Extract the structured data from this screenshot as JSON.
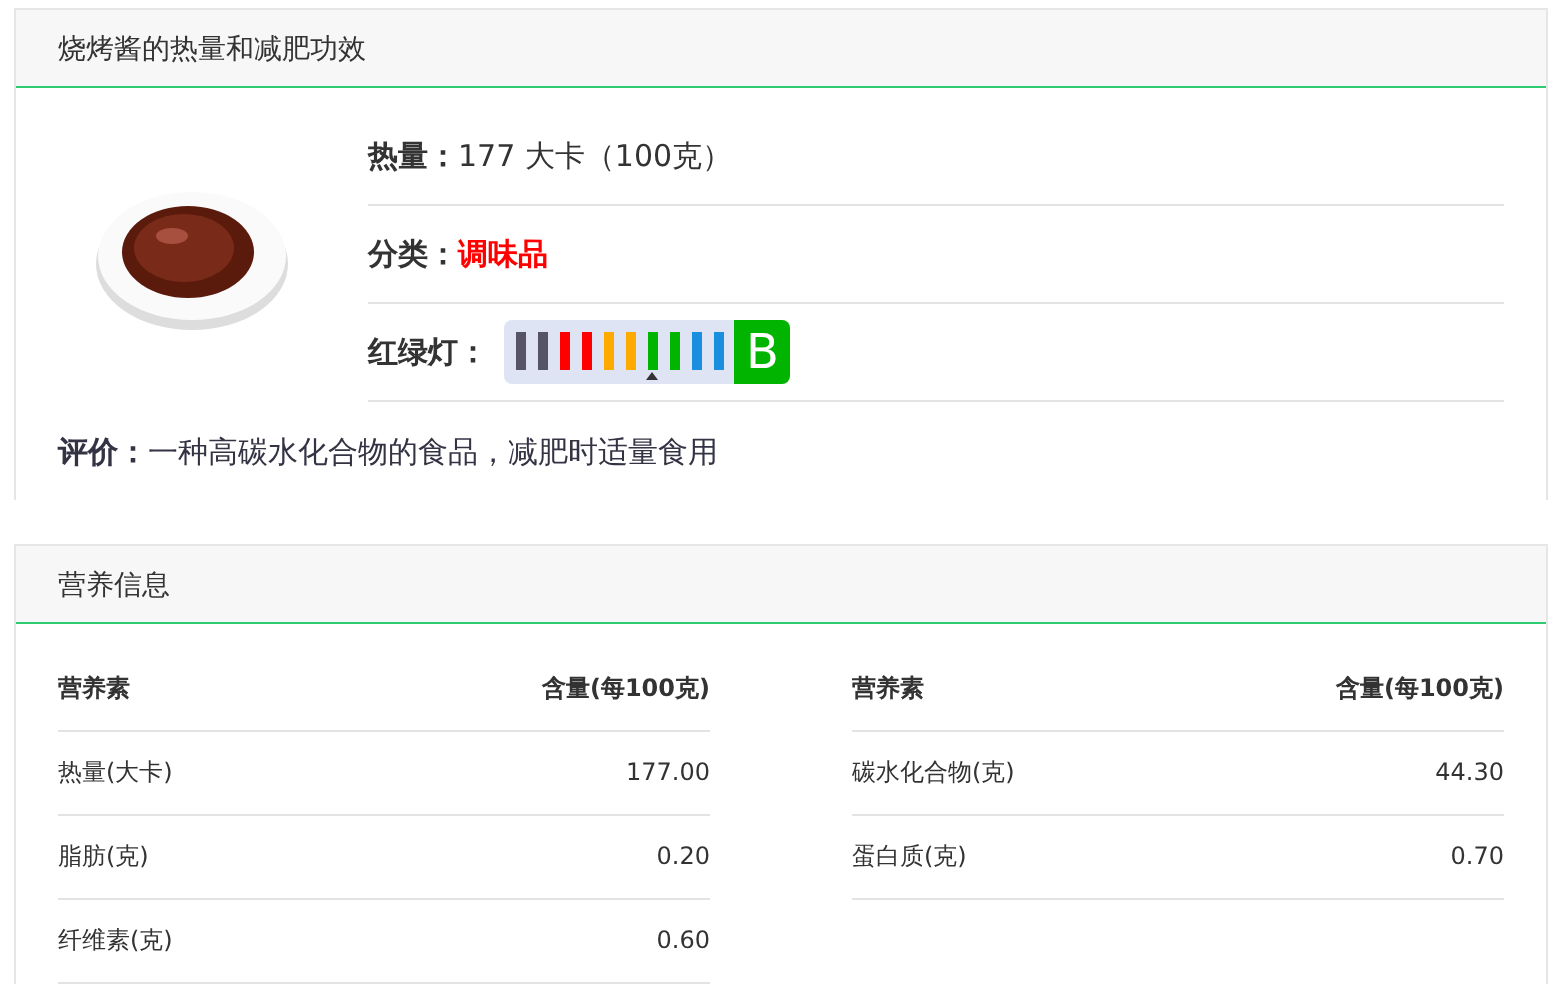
{
  "title": "烧烤酱的热量和减肥功效",
  "info": [
    {
      "kind": "text",
      "label": "热量：",
      "value": "177 大卡（100克）"
    },
    {
      "kind": "category",
      "label": "分类：",
      "value": "调味品",
      "color": "#ff0000"
    },
    {
      "kind": "light",
      "label": "红绿灯：",
      "segments": [
        {
          "color": "#555566",
          "selected": false
        },
        {
          "color": "#555566",
          "selected": false
        },
        {
          "color": "#ff0000",
          "selected": false
        },
        {
          "color": "#ff0000",
          "selected": false
        },
        {
          "color": "#ffaa00",
          "selected": false
        },
        {
          "color": "#ffaa00",
          "selected": false
        },
        {
          "color": "#00b400",
          "selected": true
        },
        {
          "color": "#00b400",
          "selected": false
        },
        {
          "color": "#1a8fe0",
          "selected": false
        },
        {
          "color": "#1a8fe0",
          "selected": false
        }
      ],
      "grade": {
        "text": "B",
        "color": "#00b400"
      }
    }
  ],
  "evaluation": {
    "label": "评价：",
    "value": "一种高碳水化合物的食品，减肥时适量食用"
  },
  "nutrition": {
    "title": "营养信息",
    "tables": [
      {
        "columns": [
          "营养素",
          "含量(每100克)"
        ],
        "rows": [
          [
            "热量(大卡)",
            "177.00"
          ],
          [
            "脂肪(克)",
            "0.20"
          ],
          [
            "纤维素(克)",
            "0.60"
          ]
        ]
      },
      {
        "columns": [
          "营养素",
          "含量(每100克)"
        ],
        "rows": [
          [
            "碳水化合物(克)",
            "44.30"
          ],
          [
            "蛋白质(克)",
            "0.70"
          ]
        ]
      }
    ]
  }
}
